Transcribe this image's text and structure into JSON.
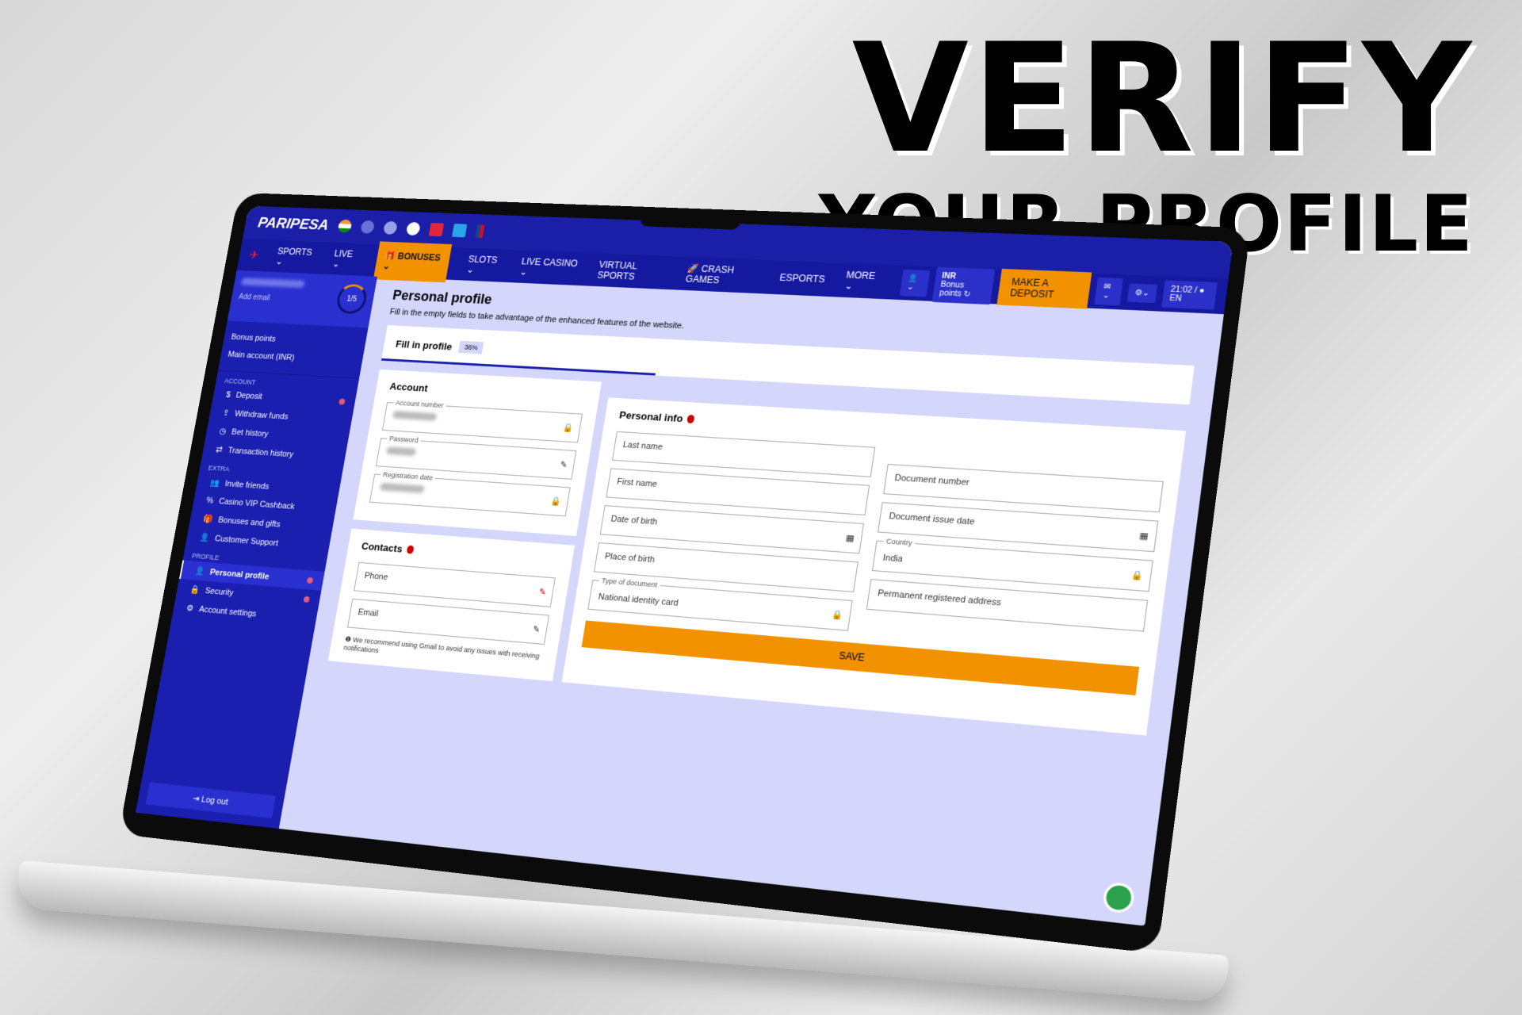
{
  "headline": {
    "line1": "VERIFY",
    "line2": "YOUR PROFILE"
  },
  "brand": {
    "logo": "PARIPESA",
    "accent": "#1b1fa8",
    "orange": "#f39200"
  },
  "league_icons": [
    "india-flag-icon",
    "champions-league-icon",
    "europa-league-icon",
    "premier-league-icon",
    "laliga-icon",
    "serie-a-icon",
    "nba-icon"
  ],
  "nav": {
    "items": [
      "SPORTS",
      "LIVE",
      "BONUSES",
      "SLOTS",
      "LIVE CASINO",
      "VIRTUAL SPORTS",
      "CRASH GAMES",
      "ESPORTS",
      "MORE"
    ]
  },
  "header": {
    "currency": "INR",
    "bonus_points": "Bonus points",
    "deposit": "MAKE A DEPOSIT",
    "time": "21:02",
    "lang": "EN"
  },
  "sidebar": {
    "add_email": "Add email",
    "progress": "1/5",
    "bonus_points": "Bonus points",
    "main_account": "Main account (INR)",
    "account_heading": "ACCOUNT",
    "extra_heading": "EXTRA",
    "profile_heading": "PROFILE",
    "account": [
      "Deposit",
      "Withdraw funds",
      "Bet history",
      "Transaction history"
    ],
    "extra": [
      "Invite friends",
      "Casino VIP Cashback",
      "Bonuses and gifts",
      "Customer Support"
    ],
    "profile": [
      "Personal profile",
      "Security",
      "Account settings"
    ],
    "logout": "Log out"
  },
  "main": {
    "title": "Personal profile",
    "subtitle": "Fill in the empty fields to take advantage of the enhanced features of the website.",
    "fill_label": "Fill in profile",
    "fill_percent": "36%",
    "fill_value": 0.36,
    "account": {
      "title": "Account",
      "account_number": "Account number",
      "password": "Password",
      "registration_date": "Registration date"
    },
    "contacts": {
      "title": "Contacts",
      "phone": "Phone",
      "email": "Email",
      "note": "We recommend using Gmail to avoid any issues with receiving notifications"
    },
    "personal": {
      "title": "Personal info",
      "last_name": "Last name",
      "first_name": "First name",
      "date_of_birth": "Date of birth",
      "place_of_birth": "Place of birth",
      "doc_type_label": "Type of document",
      "doc_type": "National identity card",
      "doc_number": "Document number",
      "doc_issue_date": "Document issue date",
      "country_label": "Country",
      "country": "India",
      "address": "Permanent registered address",
      "save": "SAVE"
    }
  }
}
